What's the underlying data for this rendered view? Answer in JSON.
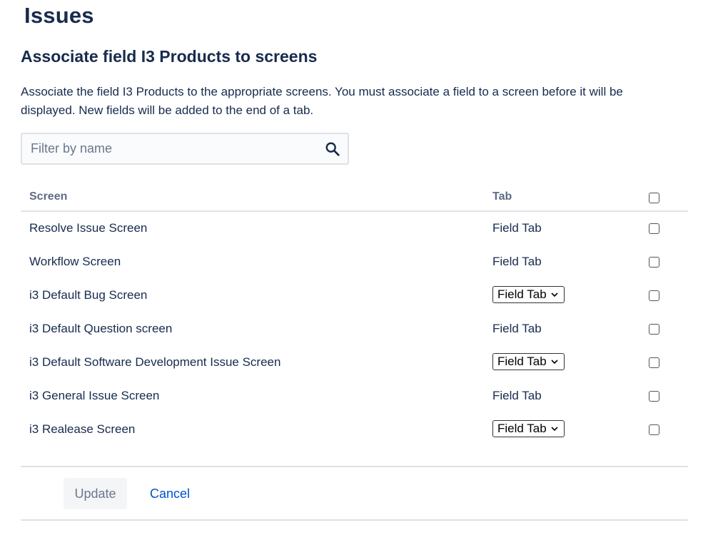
{
  "page": {
    "title": "Issues",
    "section_title": "Associate field I3 Products to screens",
    "description": "Associate the field I3 Products to the appropriate screens. You must associate a field to a screen before it will be displayed. New fields will be added to the end of a tab."
  },
  "filter": {
    "placeholder": "Filter by name",
    "value": "",
    "icon": "search-icon"
  },
  "table": {
    "columns": [
      "Screen",
      "Tab"
    ],
    "header_checkbox_checked": false,
    "rows": [
      {
        "screen": "Resolve Issue Screen",
        "tab": "Field Tab",
        "tab_is_select": false,
        "checked": false
      },
      {
        "screen": "Workflow Screen",
        "tab": "Field Tab",
        "tab_is_select": false,
        "checked": false
      },
      {
        "screen": "i3 Default Bug Screen",
        "tab": "Field Tab",
        "tab_is_select": true,
        "checked": false
      },
      {
        "screen": "i3 Default Question screen",
        "tab": "Field Tab",
        "tab_is_select": false,
        "checked": false
      },
      {
        "screen": "i3 Default Software Development Issue Screen",
        "tab": "Field Tab",
        "tab_is_select": true,
        "checked": false
      },
      {
        "screen": "i3 General Issue Screen",
        "tab": "Field Tab",
        "tab_is_select": false,
        "checked": false
      },
      {
        "screen": "i3 Realease Screen",
        "tab": "Field Tab",
        "tab_is_select": true,
        "checked": false
      }
    ]
  },
  "actions": {
    "update_label": "Update",
    "cancel_label": "Cancel"
  },
  "colors": {
    "text": "#172b4d",
    "muted": "#5e6c84",
    "link": "#0052cc",
    "border": "#dfe1e6",
    "button_bg": "#f4f5f7"
  }
}
